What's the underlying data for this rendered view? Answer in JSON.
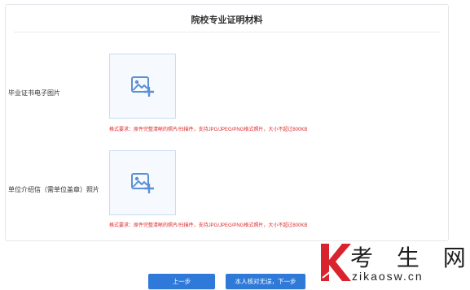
{
  "card": {
    "title": "院校专业证明材料"
  },
  "fields": [
    {
      "label": "毕业证书电子图片",
      "hint": "格式要求：原件完整清晰的照片/扫描件，支持JPG/JPEG/PNG格式照片，大小不超过800KB",
      "upload_icon": "image-add-icon"
    },
    {
      "label": "单位介绍信（需单位盖章）照片",
      "hint": "格式要求：原件完整清晰的照片/扫描件，支持JPG/JPEG/PNG格式照片，大小不超过800KB",
      "upload_icon": "image-add-icon"
    }
  ],
  "buttons": {
    "prev": "上一步",
    "next": "本人核对无误，下一步"
  },
  "watermark": {
    "text": "考 生 网",
    "url": "zikaosw.cn"
  },
  "colors": {
    "primary": "#2f7ad9",
    "hint": "#e02828",
    "watermark_red": "#d9232e"
  }
}
